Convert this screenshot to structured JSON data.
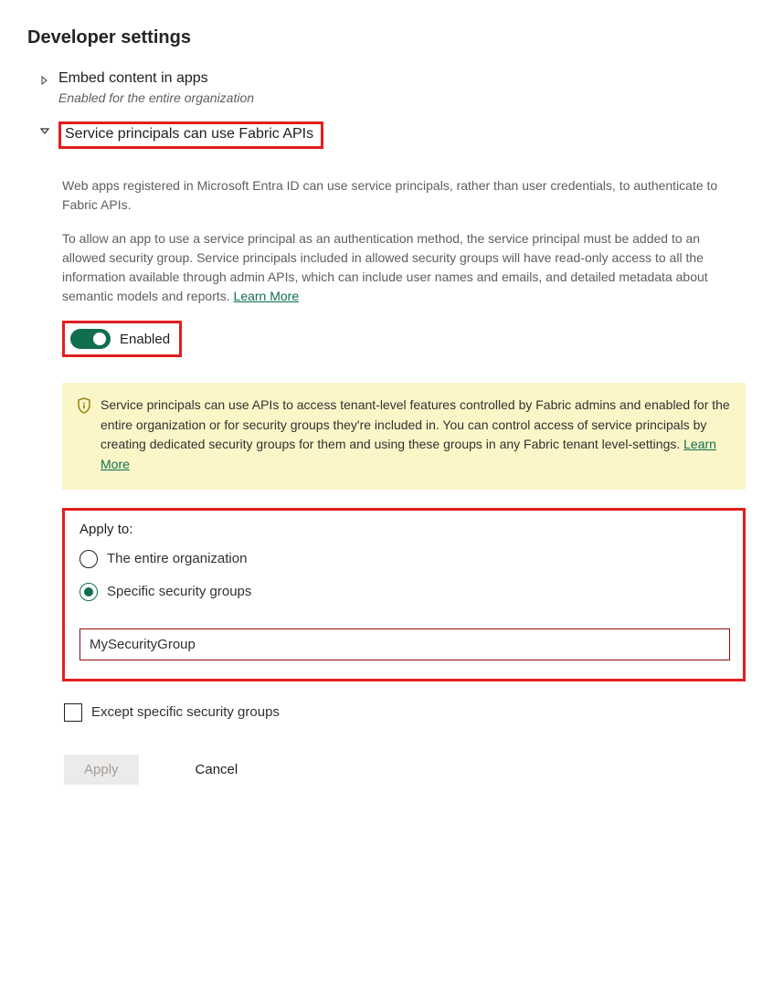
{
  "page_title": "Developer settings",
  "settings": [
    {
      "title": "Embed content in apps",
      "subtitle": "Enabled for the entire organization",
      "expanded": false
    },
    {
      "title": "Service principals can use Fabric APIs",
      "expanded": true,
      "desc1": "Web apps registered in Microsoft Entra ID can use service principals, rather than user credentials, to authenticate to Fabric APIs.",
      "desc2": "To allow an app to use a service principal as an authentication method, the service principal must be added to an allowed security group. Service principals included in allowed security groups will have read-only access to all the information available through admin APIs, which can include user names and emails, and detailed metadata about semantic models and reports.  ",
      "learn_more": "Learn More",
      "toggle_label": "Enabled",
      "info_text": "Service principals can use APIs to access tenant-level features controlled by Fabric admins and enabled for the entire organization or for security groups they're included in. You can control access of service principals by creating dedicated security groups for them and using these groups in any Fabric tenant level-settings.  ",
      "info_learn_more": "Learn More",
      "apply_to_label": "Apply to:",
      "radio1": "The entire organization",
      "radio2": "Specific security groups",
      "input_value": "MySecurityGroup",
      "except_label": "Except specific security groups",
      "apply_btn": "Apply",
      "cancel_btn": "Cancel"
    }
  ]
}
